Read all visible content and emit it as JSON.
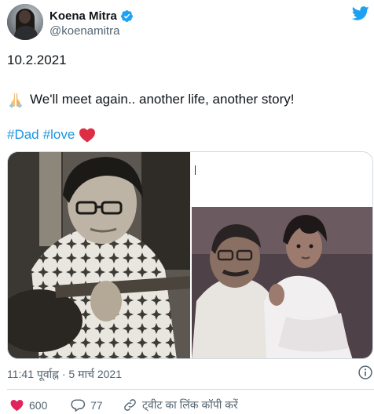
{
  "tweet": {
    "author": {
      "display_name": "Koena Mitra",
      "handle": "@koenamitra",
      "verified": true
    },
    "brand_icon": "twitter-bird-icon",
    "date_line": "10.2.2021",
    "message": "We'll meet again.. another life, another story!",
    "message_emoji": "folded-hands-icon",
    "hashtags": [
      "#Dad",
      "#love"
    ],
    "hashtag_emoji": "red-heart-icon",
    "media": [
      "photo-man-with-guitar",
      "photo-man-holding-child"
    ],
    "timestamp": "11:41 पूर्वाह्न · 5 मार्च 2021",
    "actions": {
      "like_count": "600",
      "reply_count": "77",
      "copy_link_label": "ट्वीट का लिंक कॉपी करें"
    }
  },
  "colors": {
    "brand_blue": "#1da1f2",
    "hashtag_blue": "#1b95e0",
    "text_primary": "#0f1419",
    "text_secondary": "#536471",
    "heart_red": "#e0245e",
    "divider": "#cfd9de"
  }
}
